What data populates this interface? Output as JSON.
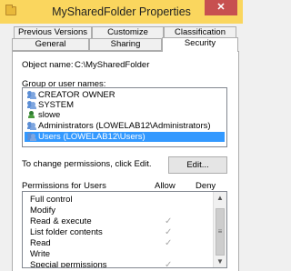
{
  "window": {
    "title": "MySharedFolder Properties",
    "close_label": "✕"
  },
  "tabs_row1": [
    "Previous Versions",
    "Customize",
    "Classification"
  ],
  "tabs_row2": [
    "General",
    "Sharing",
    "Security"
  ],
  "active_tab": "Security",
  "object": {
    "label": "Object name:",
    "value": "C:\\MySharedFolder"
  },
  "groups": {
    "label": "Group or user names:",
    "items": [
      {
        "name": "CREATOR OWNER",
        "icon": "users-icon"
      },
      {
        "name": "SYSTEM",
        "icon": "users-icon"
      },
      {
        "name": "slowe",
        "icon": "user-icon"
      },
      {
        "name": "Administrators (LOWELAB12\\Administrators)",
        "icon": "users-icon"
      },
      {
        "name": "Users (LOWELAB12\\Users)",
        "icon": "users-icon",
        "selected": true
      }
    ]
  },
  "change_text": "To change permissions, click Edit.",
  "edit_label": "Edit...",
  "permissions": {
    "header": "Permissions for Users",
    "allow_label": "Allow",
    "deny_label": "Deny",
    "check_glyph": "✓",
    "rows": [
      {
        "name": "Full control",
        "allow": false
      },
      {
        "name": "Modify",
        "allow": false
      },
      {
        "name": "Read & execute",
        "allow": true
      },
      {
        "name": "List folder contents",
        "allow": true
      },
      {
        "name": "Read",
        "allow": true
      },
      {
        "name": "Write",
        "allow": false
      },
      {
        "name": "Special permissions",
        "allow": true
      }
    ]
  },
  "scroll": {
    "up": "▲",
    "down": "▼",
    "grip": "≡"
  }
}
